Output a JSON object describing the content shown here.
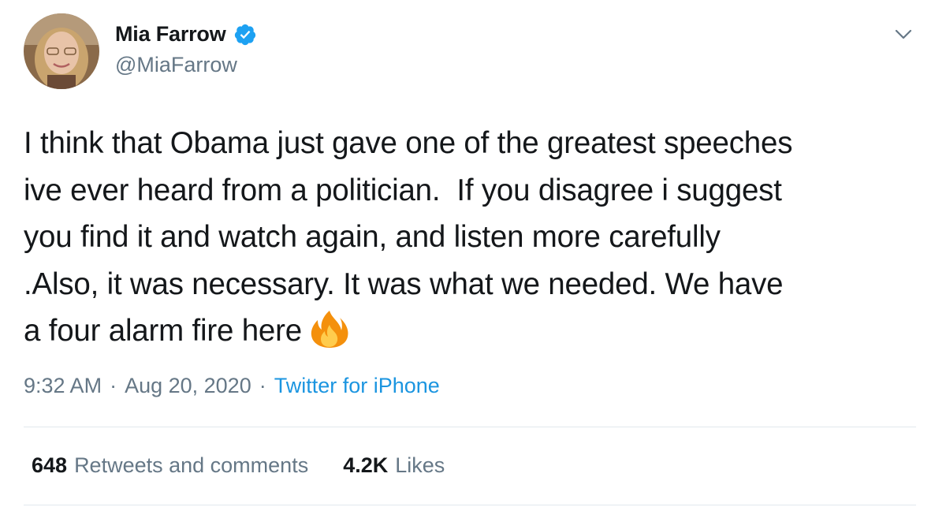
{
  "user": {
    "display_name": "Mia Farrow",
    "handle": "@MiaFarrow",
    "verified": true
  },
  "tweet": {
    "lines": [
      "I think that Obama just gave one of the greatest speeches",
      "ive ever heard from a politician.  If you disagree i suggest",
      "you find it and watch again, and listen more carefully",
      ".Also, it was necessary. It was what we needed. We have",
      "a four alarm fire here"
    ],
    "emoji": "fire-icon"
  },
  "meta": {
    "time": "9:32 AM",
    "separator": "·",
    "date": "Aug 20, 2020",
    "source": "Twitter for iPhone"
  },
  "stats": {
    "retweets_count": "648",
    "retweets_label": "Retweets and comments",
    "likes_count": "4.2K",
    "likes_label": "Likes"
  },
  "colors": {
    "text": "#14171a",
    "secondary": "#657786",
    "link": "#1b95e0",
    "verified": "#1da1f2",
    "divider": "#e1e8ed"
  }
}
